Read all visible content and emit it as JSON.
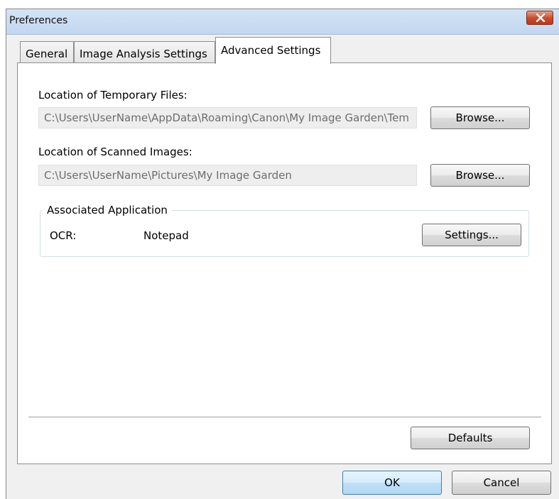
{
  "window": {
    "title": "Preferences"
  },
  "tabs": [
    {
      "label": "General",
      "active": false
    },
    {
      "label": "Image Analysis Settings",
      "active": false
    },
    {
      "label": "Advanced Settings",
      "active": true
    }
  ],
  "temporary_files": {
    "label": "Location of Temporary Files:",
    "path": "C:\\Users\\UserName\\AppData\\Roaming\\Canon\\My Image Garden\\Tem",
    "browse_label": "Browse..."
  },
  "scanned_images": {
    "label": "Location of Scanned Images:",
    "path": "C:\\Users\\UserName\\Pictures\\My Image Garden",
    "browse_label": "Browse..."
  },
  "associated_application": {
    "group_label": "Associated Application",
    "ocr_label": "OCR:",
    "ocr_value": "Notepad",
    "settings_label": "Settings..."
  },
  "footer": {
    "defaults_label": "Defaults",
    "ok_label": "OK",
    "cancel_label": "Cancel"
  },
  "colors": {
    "titlebar": "#c2d6ef",
    "close_button": "#c9492b",
    "default_button_border": "#3c7fb1"
  },
  "icons": {
    "close": "close-icon"
  }
}
